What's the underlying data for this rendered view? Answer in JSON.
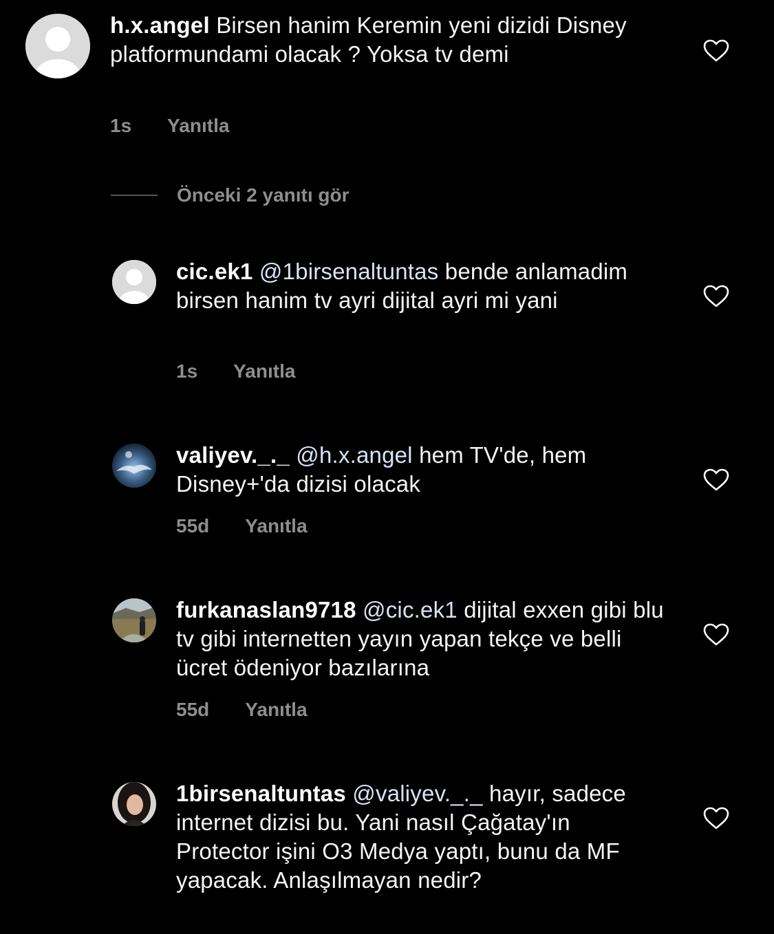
{
  "comments": [
    {
      "username": "h.x.angel",
      "mention": "",
      "text": "Birsen hanim Keremin yeni dizidi Disney platformundami olacak ? Yoksa tv demi",
      "time": "1s",
      "reply_label": "Yanıtla"
    },
    {
      "username": "cic.ek1",
      "mention": "@1birsenaltuntas",
      "text": "bende anlamadim birsen hanim tv ayri dijital ayri mi yani",
      "time": "1s",
      "reply_label": "Yanıtla"
    },
    {
      "username": "valiyev._._",
      "mention": "@h.x.angel",
      "text": "hem TV'de, hem Disney+'da dizisi olacak",
      "time": "55d",
      "reply_label": "Yanıtla"
    },
    {
      "username": "furkanaslan9718",
      "mention": "@cic.ek1",
      "text": "dijital exxen gibi blu tv gibi internetten yayın yapan tekçe ve belli ücret ödeniyor bazılarına",
      "time": "55d",
      "reply_label": "Yanıtla"
    },
    {
      "username": "1birsenaltuntas",
      "mention": "@valiyev._._",
      "text": "hayır, sadece internet dizisi bu. Yani nasıl Çağatay'ın Protector işini O3 Medya yaptı, bunu da MF yapacak. Anlaşılmayan nedir?",
      "time": "",
      "reply_label": ""
    }
  ],
  "view_replies_label": "Önceki 2 yanıtı gör",
  "colors": {
    "background": "#000000",
    "meta_gray": "#8e8e8e",
    "mention": "#d6e4f5"
  },
  "icons": {
    "heart": "heart-outline-icon",
    "default_avatar": "default-avatar-icon"
  }
}
